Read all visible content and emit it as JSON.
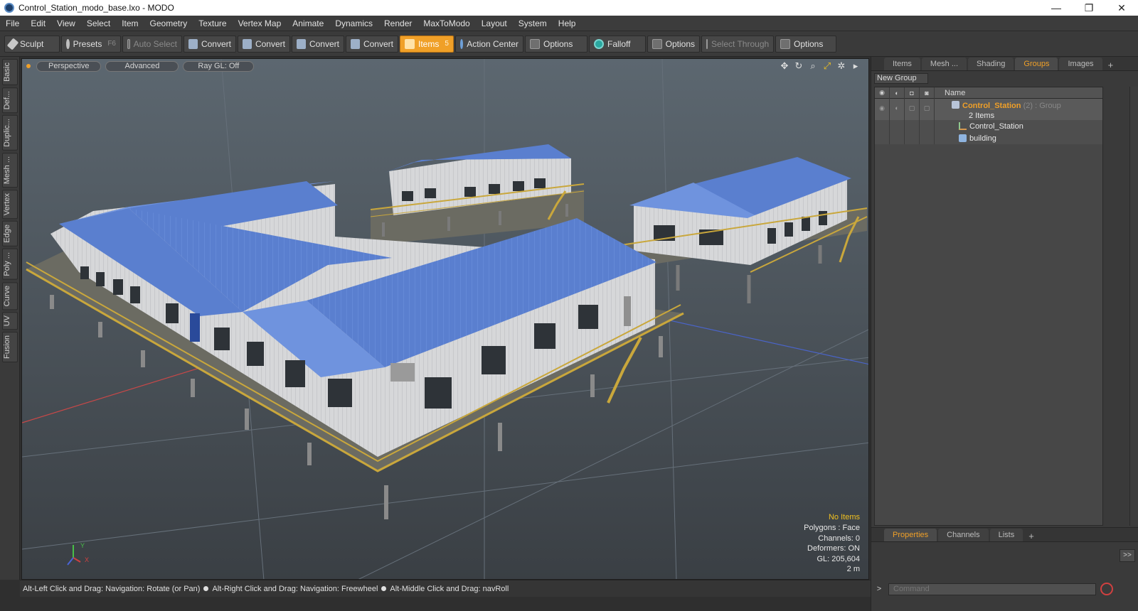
{
  "window": {
    "title": "Control_Station_modo_base.lxo - MODO",
    "minimize": "—",
    "restore": "❐",
    "close": "✕"
  },
  "menu": [
    "File",
    "Edit",
    "View",
    "Select",
    "Item",
    "Geometry",
    "Texture",
    "Vertex Map",
    "Animate",
    "Dynamics",
    "Render",
    "MaxToModo",
    "Layout",
    "System",
    "Help"
  ],
  "toolbar": {
    "sculpt": "Sculpt",
    "presets": "Presets",
    "presets_key": "F6",
    "auto_select": "Auto Select",
    "convert_1": "Convert",
    "convert_2": "Convert",
    "convert_3": "Convert",
    "convert_4": "Convert",
    "items": "Items",
    "items_key": "5",
    "action_center": "Action Center",
    "options_1": "Options",
    "falloff": "Falloff",
    "options_2": "Options",
    "select_through": "Select Through",
    "options_3": "Options"
  },
  "left_tabs": [
    "Basic",
    "Def...",
    "Duplic...",
    "Mesh ...",
    "Vertex",
    "Edge",
    "Poly ...",
    "Curve",
    "UV",
    "Fusion"
  ],
  "viewport": {
    "view_mode": "Perspective",
    "shading": "Advanced",
    "raygl": "Ray GL: Off",
    "info": {
      "no_items": "No Items",
      "polygons": "Polygons : Face",
      "channels": "Channels: 0",
      "deformers": "Deformers: ON",
      "gl": "GL: 205,604",
      "scale": "2 m"
    },
    "axis": {
      "y": "Y",
      "x": "X"
    },
    "colors": {
      "background": "#4c545b",
      "roof": "#5a7fcf",
      "wall": "#d7d8da",
      "railing": "#c9a73c",
      "grid": "#5f6870"
    }
  },
  "status": {
    "hint_1": "Alt-Left Click and Drag: Navigation: Rotate (or Pan)",
    "hint_2": "Alt-Right Click and Drag: Navigation: Freewheel",
    "hint_3": "Alt-Middle Click and Drag: navRoll"
  },
  "right_panel": {
    "tabs": [
      "Items",
      "Mesh ...",
      "Shading",
      "Groups",
      "Images"
    ],
    "active_tab": "Groups",
    "new_group": "New Group",
    "name_header": "Name",
    "group": {
      "name": "Control_Station",
      "count": "(2)",
      "type": ": Group",
      "sub": "2 Items"
    },
    "children": [
      "Control_Station",
      "building"
    ]
  },
  "lower_panel": {
    "tabs": [
      "Properties",
      "Channels",
      "Lists"
    ],
    "active_tab": "Properties",
    "expand": ">>",
    "command_placeholder": "Command"
  }
}
